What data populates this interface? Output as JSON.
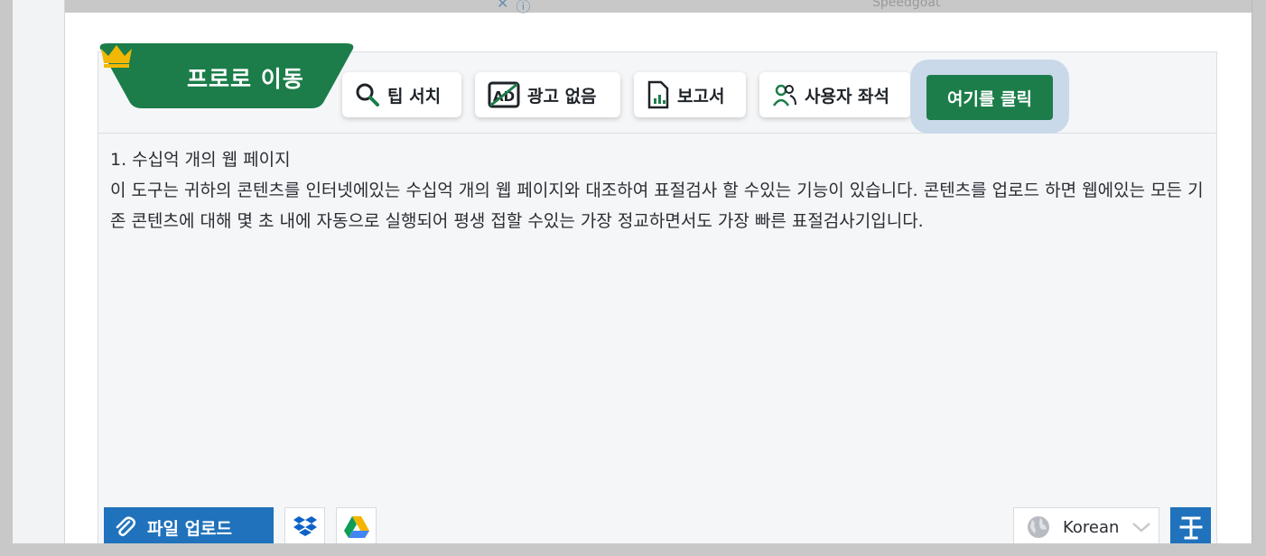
{
  "header": {
    "caption": "Speedgoat"
  },
  "toolbar": {
    "pro_label": "프로로 이동",
    "buttons": [
      {
        "label": "팁 서치",
        "icon": "search-icon"
      },
      {
        "label": "광고 없음",
        "icon": "no-ads-icon"
      },
      {
        "label": "보고서",
        "icon": "report-icon"
      },
      {
        "label": "사용자 좌석",
        "icon": "users-icon"
      }
    ],
    "cta_label": "여기를 클릭"
  },
  "content": {
    "heading": "1. 수십억 개의 웹 페이지",
    "body": "이 도구는 귀하의 콘텐츠를 인터넷에있는 수십억 개의 웹 페이지와 대조하여 표절검사 할 수있는 기능이 있습니다. 콘텐츠를 업로드 하면 웹에있는 모든 기존 콘텐츠에 대해 몇 초 내에 자동으로 실행되어 평생 접할 수있는 가장 정교하면서도 가장 빠른 표절검사기입니다."
  },
  "footer": {
    "upload_label": "파일 업로드",
    "language": "Korean"
  },
  "colors": {
    "brand_green": "#1c7d4a",
    "brand_blue": "#1f72bb",
    "crown_gold": "#f2b705"
  }
}
